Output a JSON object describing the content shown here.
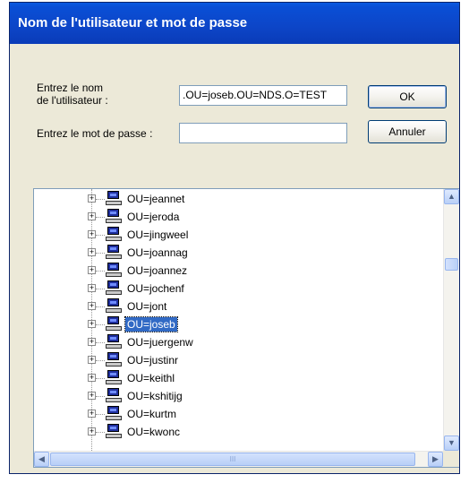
{
  "dialog": {
    "title": "Nom de l'utilisateur et mot de passe",
    "username_label_line1": "Entrez le nom",
    "username_label_line2": "de l'utilisateur :",
    "username_value": ".OU=joseb.OU=NDS.O=TEST",
    "password_label": "Entrez le mot de passe :",
    "password_value": "",
    "ok_label": "OK",
    "cancel_label": "Annuler"
  },
  "tree": {
    "items": [
      {
        "label": "OU=jeannet"
      },
      {
        "label": "OU=jeroda"
      },
      {
        "label": "OU=jingweel"
      },
      {
        "label": "OU=joannag"
      },
      {
        "label": "OU=joannez"
      },
      {
        "label": "OU=jochenf"
      },
      {
        "label": "OU=jont"
      },
      {
        "label": "OU=joseb"
      },
      {
        "label": "OU=juergenw"
      },
      {
        "label": "OU=justinr"
      },
      {
        "label": "OU=keithl"
      },
      {
        "label": "OU=kshitijg"
      },
      {
        "label": "OU=kurtm"
      },
      {
        "label": "OU=kwonc"
      }
    ],
    "selected_index": 7,
    "expander_symbol": "+",
    "icon": "computer-icon"
  },
  "scrollbars": {
    "up_arrow": "▲",
    "down_arrow": "▼",
    "left_arrow": "◀",
    "right_arrow": "▶",
    "h_thumb_grip": "III"
  }
}
